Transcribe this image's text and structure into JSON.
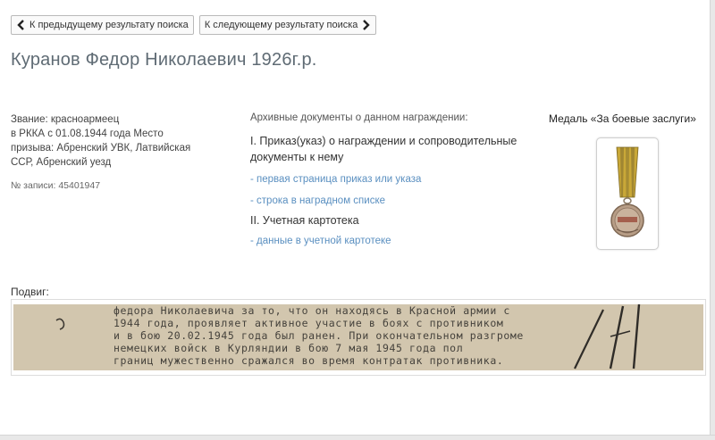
{
  "nav": {
    "prev_label": "К предыдущему результату поиска",
    "next_label": "К следующему результату поиска"
  },
  "person": {
    "name": "Куранов Федор Николаевич 1926г.р.",
    "details": [
      "Звание: красноармеец",
      "в РККА с 01.08.1944 года Место",
      "призыва: Абренский УВК, Латвийская",
      "ССР, Абренский уезд"
    ],
    "record": "№ записи: 45401947"
  },
  "documents": {
    "heading": "Архивные документы о данном награждении:",
    "section1": "I. Приказ(указ) о награждении и сопроводительные документы к нему",
    "link_first_page": "- первая страница приказ или указа",
    "link_award_line": "- строка в наградном списке",
    "section2": "II. Учетная картотека",
    "link_card": "- данные в учетной картотеке"
  },
  "award": {
    "name": "Медаль «За боевые заслуги»",
    "image_icon": "medal-za-boevye-zaslugi"
  },
  "feat": {
    "label": "Подвиг:",
    "text_lines": [
      "федора Николаевича за то, что он находясь в Красной армии с",
      "1944 года, проявляет активное участие в боях с противником",
      "и в бою 20.02.1945 года был ранен. При окончательном разгроме",
      "немецких войск в Курляндии в бою 7 мая 1945 года пол",
      "границ мужественно сражался во время контратак противника."
    ]
  },
  "colors": {
    "title": "#5f6b74",
    "link": "#5a8fc0",
    "scan_paper": "#d2c6ae"
  }
}
